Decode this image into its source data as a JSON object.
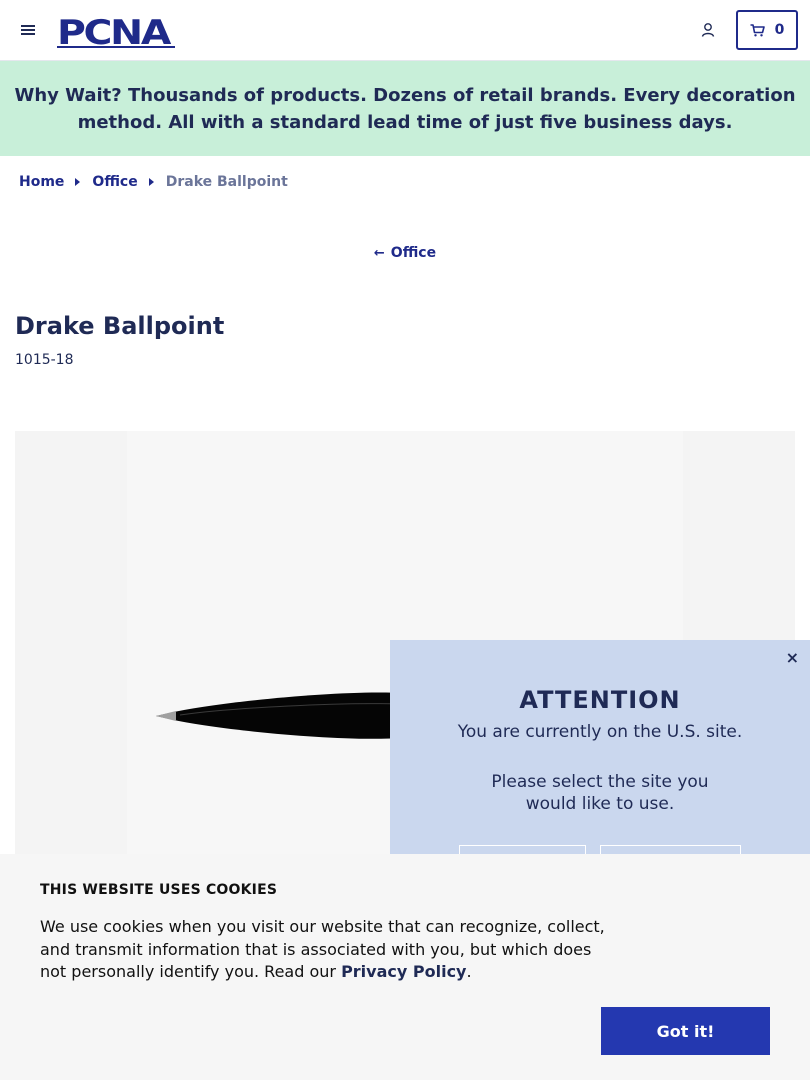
{
  "header": {
    "logo_text": "PCNA",
    "cart_count": "0",
    "icons": [
      "menu-icon",
      "account-icon",
      "cart-icon"
    ]
  },
  "promo": {
    "text": "Why Wait? Thousands of products. Dozens of retail brands. Every decoration method. All with a standard lead time of just five business days."
  },
  "breadcrumb": {
    "items": [
      "Home",
      "Office"
    ],
    "current": "Drake Ballpoint"
  },
  "back_link": {
    "label": "Office"
  },
  "product": {
    "title": "Drake Ballpoint",
    "sku": "1015-18"
  },
  "attention": {
    "close": "×",
    "title": "ATTENTION",
    "line1": "You are currently on the U.S. site.",
    "line2": "Please select the site you would like to use."
  },
  "cookie": {
    "title": "THIS WEBSITE USES COOKIES",
    "text": "We use cookies when you visit our website that can recognize, collect, and transmit information that is associated with you, but which does not personally identify you. Read our",
    "link": "Privacy Policy",
    "period": ".",
    "button": "Got it!"
  },
  "colors": {
    "brand": "#1f2a8a",
    "promo_bg": "#c8efd9",
    "attention_bg": "#cad7ee",
    "button_bg": "#2438b0"
  }
}
